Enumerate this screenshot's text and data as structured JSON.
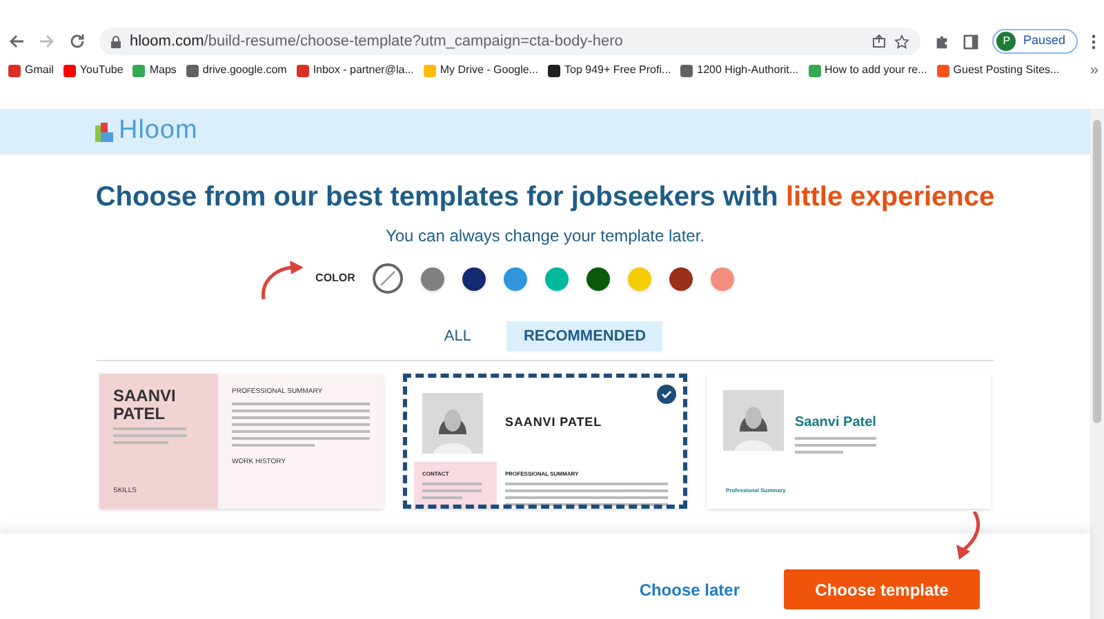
{
  "browser": {
    "url_host": "hloom.com",
    "url_path": "/build-resume/choose-template?utm_campaign=cta-body-hero",
    "profile": "P",
    "profile_status": "Paused",
    "bookmarks": [
      {
        "label": "Gmail",
        "color": "#d93025"
      },
      {
        "label": "YouTube",
        "color": "#ff0000"
      },
      {
        "label": "Maps",
        "color": "#34a853"
      },
      {
        "label": "drive.google.com",
        "color": "#5f6368"
      },
      {
        "label": "Inbox - partner@la...",
        "color": "#d93025"
      },
      {
        "label": "My Drive - Google...",
        "color": "#fbbc04"
      },
      {
        "label": "Top 949+ Free Profi...",
        "color": "#202124"
      },
      {
        "label": "1200 High-Authorit...",
        "color": "#5f6368"
      },
      {
        "label": "How to add your re...",
        "color": "#34a853"
      },
      {
        "label": "Guest Posting Sites...",
        "color": "#f4511e"
      }
    ],
    "more": "»"
  },
  "site": {
    "logo": "Hloom",
    "heading": {
      "text": "Choose from our best templates for jobseekers with",
      "highlight": "little experience"
    },
    "subtitle": "You can always change your template later.",
    "color_label": "COLOR",
    "colors": [
      {
        "kind": "none",
        "selected": true
      },
      {
        "kind": "swatch",
        "color": "#808080",
        "selected": false
      },
      {
        "kind": "swatch",
        "color": "#14296e",
        "selected": false
      },
      {
        "kind": "swatch",
        "color": "#2f96dd",
        "selected": false
      },
      {
        "kind": "swatch",
        "color": "#00b89c",
        "selected": false
      },
      {
        "kind": "swatch",
        "color": "#0b5a0b",
        "selected": false
      },
      {
        "kind": "swatch",
        "color": "#f5cd05",
        "selected": false
      },
      {
        "kind": "swatch",
        "color": "#982f1a",
        "selected": false
      },
      {
        "kind": "swatch",
        "color": "#f38e7c",
        "selected": false
      }
    ],
    "tabs": [
      {
        "label": "ALL",
        "selected": false
      },
      {
        "label": "RECOMMENDED",
        "selected": true
      }
    ],
    "templates": [
      {
        "kind": "sidebar",
        "selected": false,
        "name": "SAANVI PATEL",
        "summary": "PROFESSIONAL SUMMARY",
        "skills": "SKILLS",
        "work": "WORK HISTORY"
      },
      {
        "kind": "banner",
        "selected": true,
        "name": "SAANVI PATEL",
        "contact": "CONTACT",
        "summary": "PROFESSIONAL SUMMARY"
      },
      {
        "kind": "timeline",
        "selected": false,
        "name": "Saanvi Patel",
        "summary": "Professional Summary"
      }
    ],
    "choose_later": "Choose later",
    "choose_template": "Choose template"
  }
}
